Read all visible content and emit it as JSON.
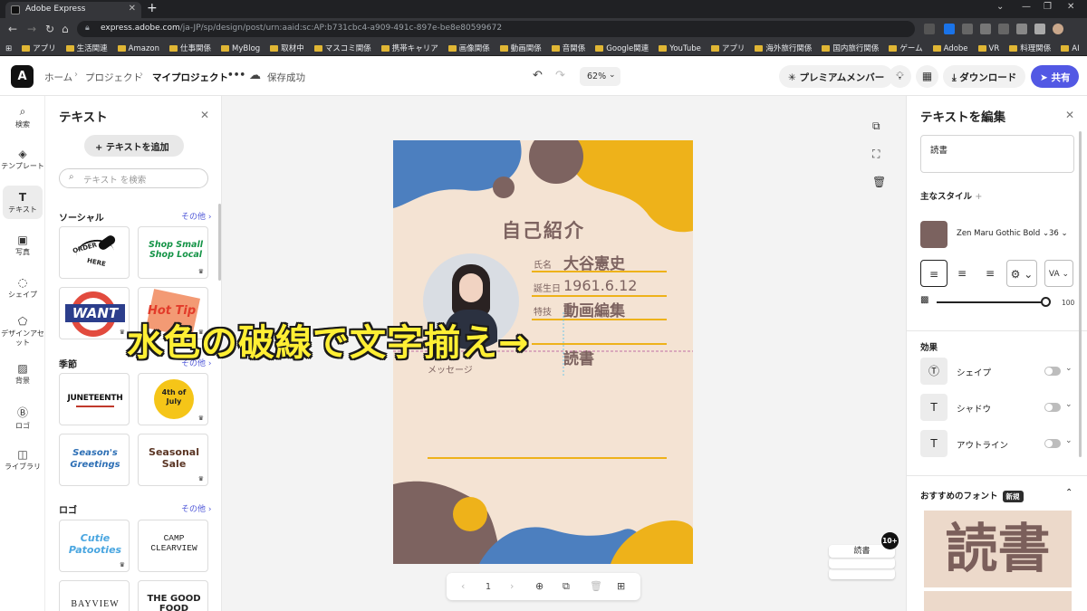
{
  "browser": {
    "tab_title": "Adobe Express",
    "url_host": "express.adobe.com",
    "url_path": "/ja-JP/sp/design/post/urn:aaid:sc:AP:b731cbc4-a909-491c-897e-be8e80599672",
    "bookmarks": [
      "アプリ",
      "生活関連",
      "Amazon",
      "仕事関係",
      "MyBlog",
      "取材中",
      "マスコミ関係",
      "携帯キャリア",
      "画像関係",
      "動画関係",
      "音関係",
      "Google関連",
      "YouTube",
      "アプリ",
      "海外旅行関係",
      "国内旅行関係",
      "ゲーム",
      "Adobe",
      "VR",
      "料理関係",
      "AI"
    ]
  },
  "header": {
    "logo_text": "A",
    "breadcrumb": [
      "ホーム",
      "プロジェクト",
      "マイプロジェクト"
    ],
    "more": "•••",
    "save_status": "保存成功",
    "zoom": "62%",
    "premium": "プレミアムメンバー",
    "download": "ダウンロード",
    "share": "共有"
  },
  "rail": [
    {
      "label": "検索",
      "icon": "search-icon",
      "glyph": "⌕"
    },
    {
      "label": "テンプレート",
      "icon": "template-icon",
      "glyph": "◈"
    },
    {
      "label": "テキスト",
      "icon": "text-icon",
      "glyph": "T"
    },
    {
      "label": "写真",
      "icon": "photo-icon",
      "glyph": "▣"
    },
    {
      "label": "シェイプ",
      "icon": "shape-icon",
      "glyph": "◌"
    },
    {
      "label": "デザインアセット",
      "icon": "design-asset-icon",
      "glyph": "⬠"
    },
    {
      "label": "背景",
      "icon": "background-icon",
      "glyph": "▨"
    },
    {
      "label": "ロゴ",
      "icon": "logo-icon",
      "glyph": "Ⓑ"
    },
    {
      "label": "ライブラリ",
      "icon": "library-icon",
      "glyph": "◫"
    }
  ],
  "text_panel": {
    "title": "テキスト",
    "add_button": "テキストを追加",
    "search_placeholder": "テキスト を検索",
    "sections": [
      {
        "name": "ソーシャル",
        "more": "その他"
      },
      {
        "name": "季節",
        "more": "その他"
      },
      {
        "name": "ロゴ",
        "more": "その他"
      }
    ],
    "tiles": {
      "order_here": [
        "ORDER",
        "HERE"
      ],
      "shop_small": "Shop Small Shop Local",
      "want": "WANT",
      "hot_tip": "Hot Tip",
      "juneteenth": "JUNETEENTH",
      "fourth": "4th of July",
      "seasons": "Season's Greetings",
      "seasonal": "Seasonal Sale",
      "cutie": "Cutie Patooties",
      "camp": "CAMP CLEARVIEW",
      "bayview": "BAYVIEW",
      "good_food": "THE GOOD FOOD"
    }
  },
  "design": {
    "title": "自己紹介",
    "fields": [
      {
        "label": "氏名",
        "value": "大谷憲史"
      },
      {
        "label": "誕生日",
        "value": "1961.6.12"
      },
      {
        "label": "特技",
        "value": "動画編集"
      }
    ],
    "selected_text": "読書",
    "message_label": "メッセージ"
  },
  "page_nav": {
    "page": "1"
  },
  "stack_badge": "10+",
  "stack_preview": "読書",
  "right_panel": {
    "title": "テキストを編集",
    "edit_value": "読書",
    "main_style": "主なスタイル",
    "font": "Zen Maru Gothic Bold",
    "size": "36",
    "opacity": "100",
    "effects_title": "効果",
    "effects": [
      "シェイプ",
      "シャドウ",
      "アウトライン"
    ],
    "recommended": "おすすめのフォント",
    "new_badge": "新規",
    "preview": "読書",
    "swatch_color": "#7b625f"
  },
  "caption": "水色の破線で文字揃え→"
}
